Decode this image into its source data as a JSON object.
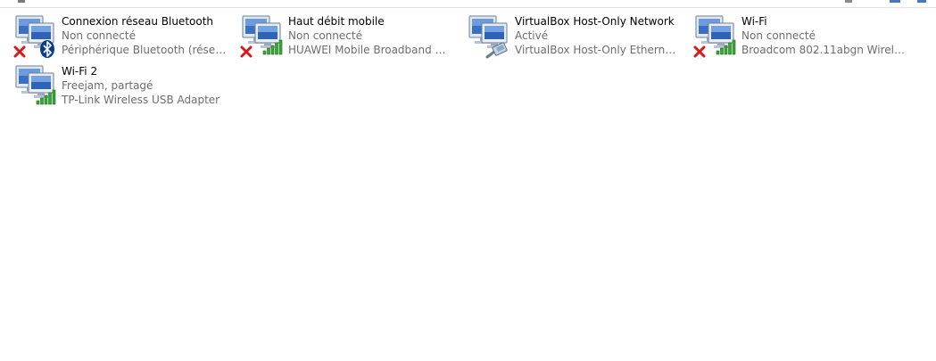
{
  "colors": {
    "name_text": "#000000",
    "secondary_text": "#6d6d6d",
    "disconnected_x": "#d61a1a",
    "signal_green": "#3aa63a",
    "bluetooth_blue": "#0a3c8a"
  },
  "connections": [
    {
      "name": "Connexion réseau Bluetooth",
      "status": "Non connecté",
      "device": "Périphérique Bluetooth (réseau p...",
      "overlay_icon": "bluetooth-icon",
      "disconnected": true
    },
    {
      "name": "Haut débit mobile",
      "status": "Non connecté",
      "device": "HUAWEI Mobile Broadband Mod...",
      "overlay_icon": "signal-bars-icon",
      "disconnected": true
    },
    {
      "name": "VirtualBox Host-Only Network",
      "status": "Activé",
      "device": "VirtualBox Host-Only Ethernet Ad...",
      "overlay_icon": "ethernet-cable-icon",
      "disconnected": false
    },
    {
      "name": "Wi-Fi",
      "status": "Non connecté",
      "device": "Broadcom 802.11abgn Wireless S...",
      "overlay_icon": "signal-bars-icon",
      "disconnected": true
    },
    {
      "name": "Wi-Fi 2",
      "status": "Freejam, partagé",
      "device": "TP-Link Wireless USB Adapter",
      "overlay_icon": "signal-bars-icon",
      "disconnected": false
    }
  ]
}
